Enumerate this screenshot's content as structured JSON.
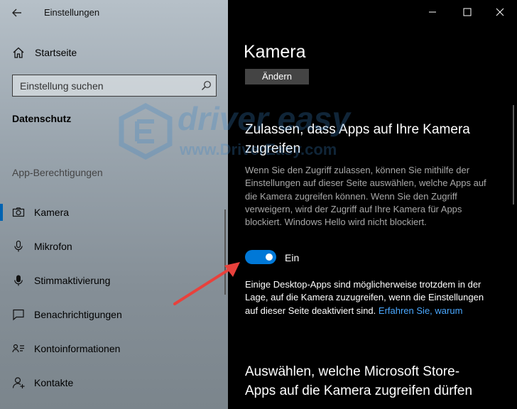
{
  "window": {
    "title": "Einstellungen"
  },
  "sidebar": {
    "home_label": "Startseite",
    "search_placeholder": "Einstellung suchen",
    "section_title": "Datenschutz",
    "group_title": "App-Berechtigungen",
    "items": [
      {
        "label": "Kamera",
        "icon": "camera-icon",
        "selected": true
      },
      {
        "label": "Mikrofon",
        "icon": "microphone-icon"
      },
      {
        "label": "Stimmaktivierung",
        "icon": "voice-activation-icon"
      },
      {
        "label": "Benachrichtigungen",
        "icon": "notifications-icon"
      },
      {
        "label": "Kontoinformationen",
        "icon": "account-info-icon"
      },
      {
        "label": "Kontakte",
        "icon": "contacts-icon"
      }
    ]
  },
  "main": {
    "page_title": "Kamera",
    "change_button": "Ändern",
    "heading": "Zulassen, dass Apps auf Ihre Kamera zugreifen",
    "description": "Wenn Sie den Zugriff zulassen, können Sie mithilfe der Einstellungen auf dieser Seite auswählen, welche Apps auf die Kamera zugreifen können. Wenn Sie den Zugriff verweigern, wird der Zugriff auf Ihre Kamera für Apps blockiert. Windows Hello wird nicht blockiert.",
    "toggle": {
      "state_label": "Ein",
      "on": true
    },
    "note_text": "Einige Desktop-Apps sind möglicherweise trotzdem in der Lage, auf die Kamera zuzugreifen, wenn die Einstellungen auf dieser Seite deaktiviert sind.",
    "note_link": "Erfahren Sie, warum",
    "heading2": "Auswählen, welche Microsoft Store-Apps auf die Kamera zugreifen dürfen"
  },
  "watermark": {
    "line1": "driver easy",
    "line2": "www.DriverEasy.com"
  },
  "colors": {
    "accent": "#0078d7",
    "link": "#4aa8ff",
    "arrow": "#e8413c"
  }
}
